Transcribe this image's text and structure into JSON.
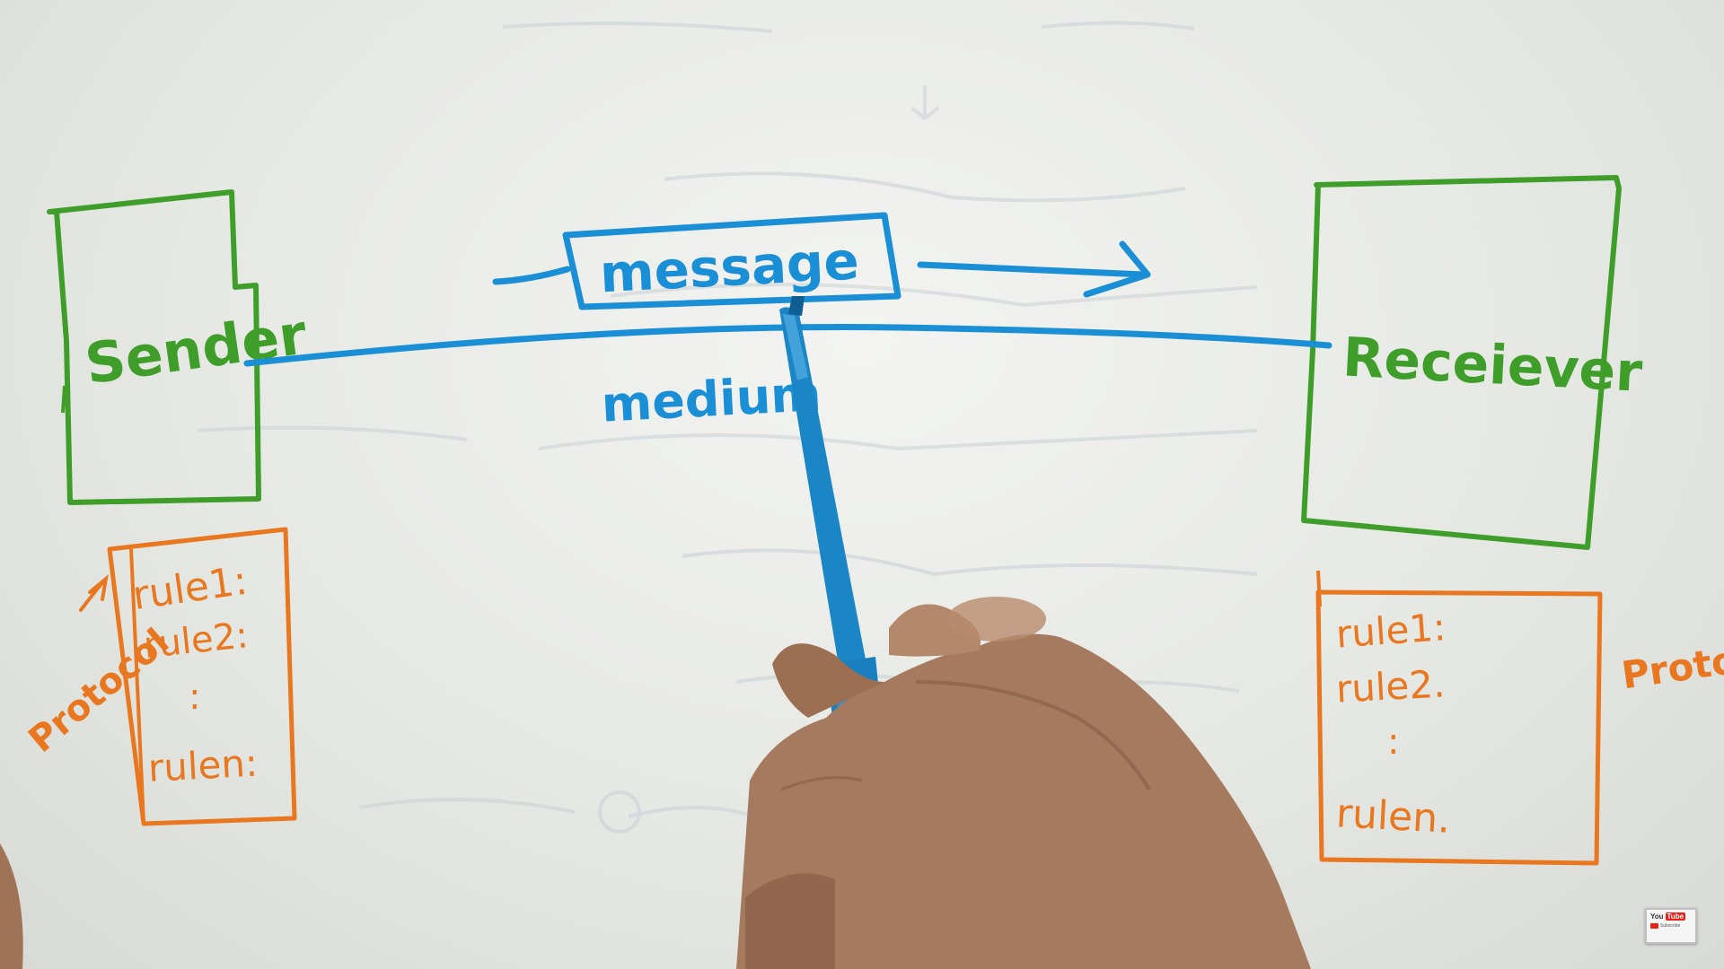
{
  "diagram": {
    "sender_label": "Sender",
    "receiver_label": "Receiever",
    "message_label": "message",
    "medium_label": "medium",
    "protocol_left_label": "Protocol",
    "protocol_right_label": "Proto",
    "sender_rules": [
      "rule1:",
      "rule2:",
      ":",
      "rulen:"
    ],
    "receiver_rules": [
      "rule1:",
      "rule2.",
      ":",
      "rulen."
    ]
  },
  "colors": {
    "green": "#3f9e2a",
    "blue": "#1a8fd6",
    "orange": "#e8771f",
    "skin": "#a87d62",
    "board": "#eef0ec"
  },
  "badge": {
    "you": "You",
    "tube": "Tube",
    "subscribe": "Subscribe"
  }
}
